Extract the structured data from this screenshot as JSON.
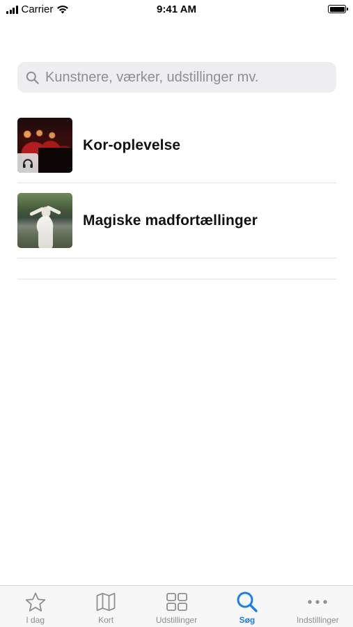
{
  "status_bar": {
    "carrier": "Carrier",
    "time": "9:41 AM"
  },
  "search": {
    "placeholder": "Kunstnere, værker, udstillinger mv.",
    "value": ""
  },
  "results": [
    {
      "title": "Kor-oplevelse",
      "thumbnail": "choir-photo",
      "badge_icon": "headphones-icon"
    },
    {
      "title": "Magiske madfortællinger",
      "thumbnail": "woman-in-white-dress-photo"
    }
  ],
  "tabs": [
    {
      "label": "I dag",
      "icon": "star-icon",
      "active": false
    },
    {
      "label": "Kort",
      "icon": "map-icon",
      "active": false
    },
    {
      "label": "Udstillinger",
      "icon": "grid-icon",
      "active": false
    },
    {
      "label": "Søg",
      "icon": "search-icon",
      "active": true
    },
    {
      "label": "Indstillinger",
      "icon": "more-icon",
      "active": false
    }
  ],
  "colors": {
    "accent": "#1a7cf2",
    "inactive_tab": "#8e8e93",
    "search_background": "#eeeef0"
  }
}
